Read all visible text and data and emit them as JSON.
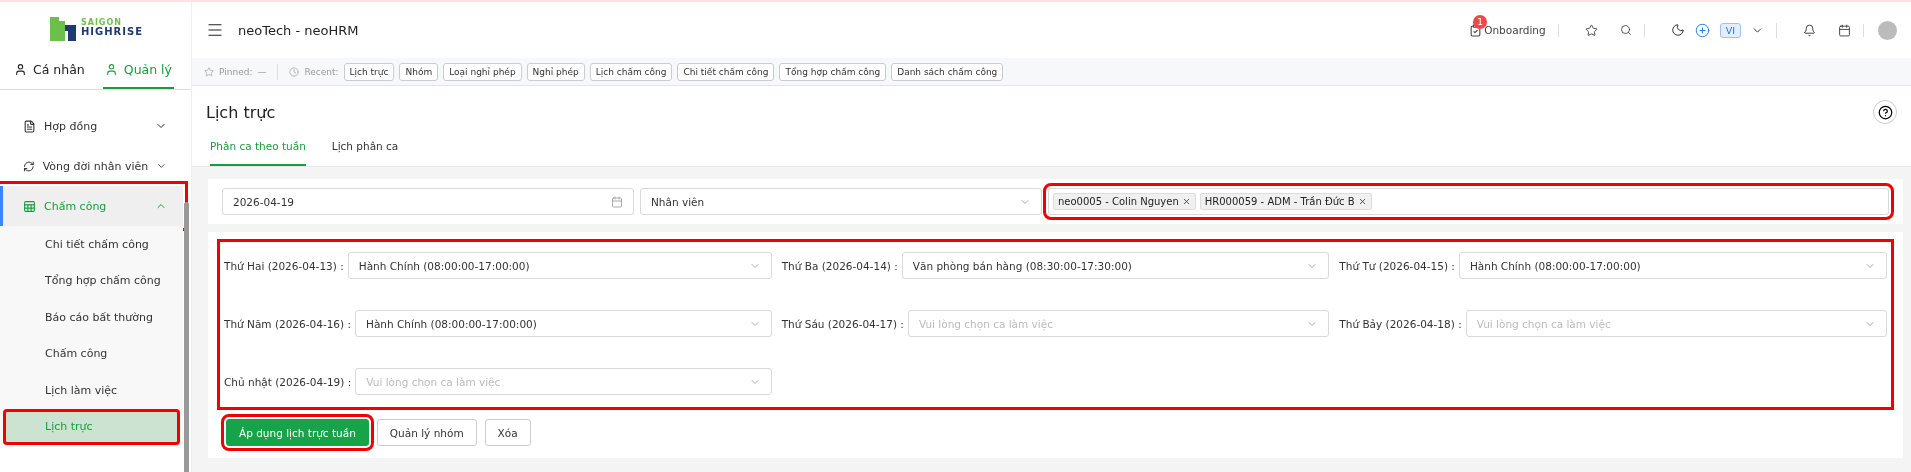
{
  "logo": {
    "top": "SAIGON",
    "bottom": "HIGHRISE"
  },
  "sidebar": {
    "tabs": [
      {
        "label": "Cá nhân",
        "selected": false
      },
      {
        "label": "Quản lý",
        "selected": true
      }
    ],
    "items": [
      {
        "label": "Hợp đồng",
        "expanded": false,
        "highlighted": false
      },
      {
        "label": "Vòng đời nhân viên",
        "expanded": false,
        "highlighted": false
      },
      {
        "label": "Chấm công",
        "expanded": true,
        "highlighted": true,
        "children": [
          {
            "label": "Chi tiết chấm công",
            "selected": false,
            "highlighted": false
          },
          {
            "label": "Tổng hợp chấm công",
            "selected": false,
            "highlighted": false
          },
          {
            "label": "Báo cáo bất thường",
            "selected": false,
            "highlighted": false
          },
          {
            "label": "Chấm công",
            "selected": false,
            "highlighted": false
          },
          {
            "label": "Lịch làm việc",
            "selected": false,
            "highlighted": false
          },
          {
            "label": "Lịch trực",
            "selected": true,
            "highlighted": true
          }
        ]
      }
    ]
  },
  "header": {
    "title": "neoTech - neoHRM",
    "onboarding": {
      "label": "Onboarding",
      "badge": "1"
    },
    "language": "VI"
  },
  "recent_bar": {
    "pinned_label": "Pinned:",
    "pinned_value": "—",
    "recent_label": "Recent:",
    "items": [
      "Lịch trực",
      "Nhóm",
      "Loại nghỉ phép",
      "Nghỉ phép",
      "Lịch chấm công",
      "Chi tiết chấm công",
      "Tổng hợp chấm công",
      "Danh sách chấm công"
    ]
  },
  "page": {
    "title": "Lịch trực",
    "tabs": [
      {
        "label": "Phân ca theo tuần",
        "selected": true
      },
      {
        "label": "Lịch phân ca",
        "selected": false
      }
    ]
  },
  "filters": {
    "date": "2026-04-19",
    "employee_type": "Nhân viên",
    "employees": {
      "highlighted": true,
      "tags": [
        "neo0005 - Colin Nguyen",
        "HR000059 - ADM - Trần Đức B"
      ]
    }
  },
  "schedule": {
    "highlighted": true,
    "days": [
      {
        "label": "Thứ Hai (2026-04-13) :",
        "value": "Hành Chính (08:00:00-17:00:00)"
      },
      {
        "label": "Thứ Ba (2026-04-14) :",
        "value": "Văn phòng bán hàng (08:30:00-17:30:00)"
      },
      {
        "label": "Thứ Tư (2026-04-15) :",
        "value": "Hành Chính (08:00:00-17:00:00)"
      },
      {
        "label": "Thứ Năm (2026-04-16) :",
        "value": "Hành Chính (08:00:00-17:00:00)"
      },
      {
        "label": "Thứ Sáu (2026-04-17) :",
        "placeholder": "Vui lòng chọn ca làm việc"
      },
      {
        "label": "Thứ Bảy (2026-04-18) :",
        "placeholder": "Vui lòng chọn ca làm việc"
      },
      {
        "label": "Chủ nhật (2026-04-19) :",
        "placeholder": "Vui lòng chọn ca làm việc"
      }
    ]
  },
  "actions": [
    {
      "label": "Áp dụng lịch trực tuần",
      "kind": "primary",
      "highlighted": true
    },
    {
      "label": "Quản lý nhóm",
      "kind": "default",
      "highlighted": false
    },
    {
      "label": "Xóa",
      "kind": "default",
      "highlighted": false
    }
  ]
}
